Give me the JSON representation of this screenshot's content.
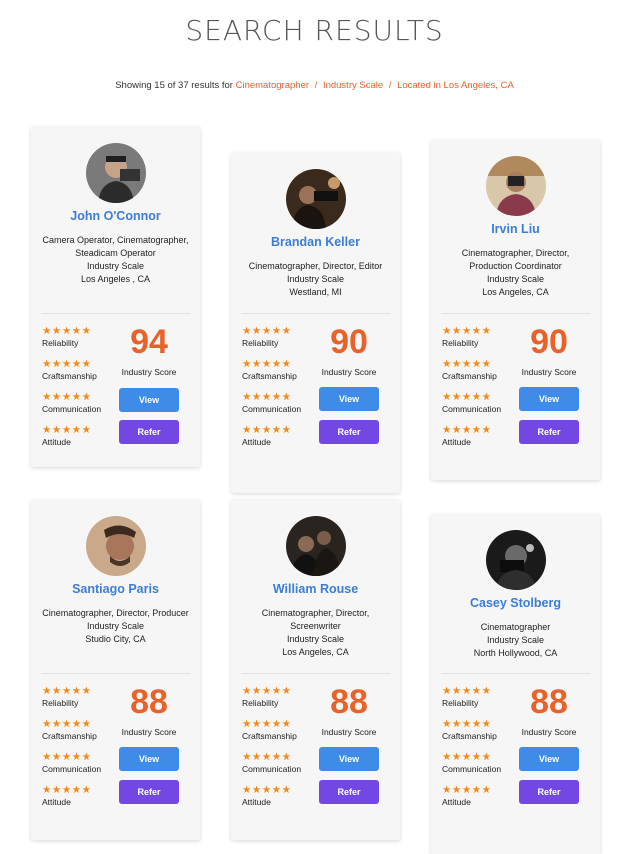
{
  "page": {
    "title": "SEARCH RESULTS",
    "summary_prefix": "Showing 15 of 37 results for",
    "filters": [
      "Cinematographer",
      "Industry Scale",
      "Located in Los Angeles, CA"
    ],
    "filter_separator": "/"
  },
  "rating_labels": [
    "Reliability",
    "Craftsmanship",
    "Communication",
    "Attitude"
  ],
  "stars": "★★★★★",
  "score_label": "Industry Score",
  "view_label": "View",
  "refer_label": "Refer",
  "colors": {
    "accent_orange": "#e8622a",
    "link_blue": "#3b7dd8",
    "view_button": "#3f8ce8",
    "refer_button": "#7347e3",
    "star": "#f08a1c"
  },
  "results": [
    {
      "name": "John O'Connor",
      "roles": "Camera Operator, Cinematographer, Steadicam Operator",
      "scale": "Industry Scale",
      "location": "Los Angeles , CA",
      "score": 94,
      "star_rating": 5
    },
    {
      "name": "Brandan Keller",
      "roles": "Cinematographer, Director, Editor",
      "scale": "Industry Scale",
      "location": "Westland, MI",
      "score": 90,
      "star_rating": 5
    },
    {
      "name": "Irvin Liu",
      "roles": "Cinematographer, Director, Production Coordinator",
      "scale": "Industry Scale",
      "location": "Los Angeles, CA",
      "score": 90,
      "star_rating": 5
    },
    {
      "name": "Santiago Paris",
      "roles": "Cinematographer, Director, Producer",
      "scale": "Industry Scale",
      "location": "Studio City, CA",
      "score": 88,
      "star_rating": 5
    },
    {
      "name": "William Rouse",
      "roles": "Cinematographer, Director, Screenwriter",
      "scale": "Industry Scale",
      "location": "Los Angeles, CA",
      "score": 88,
      "star_rating": 5
    },
    {
      "name": "Casey Stolberg",
      "roles": "Cinematographer",
      "scale": "Industry Scale",
      "location": "North Hollywood, CA",
      "score": 88,
      "star_rating": 5
    }
  ]
}
